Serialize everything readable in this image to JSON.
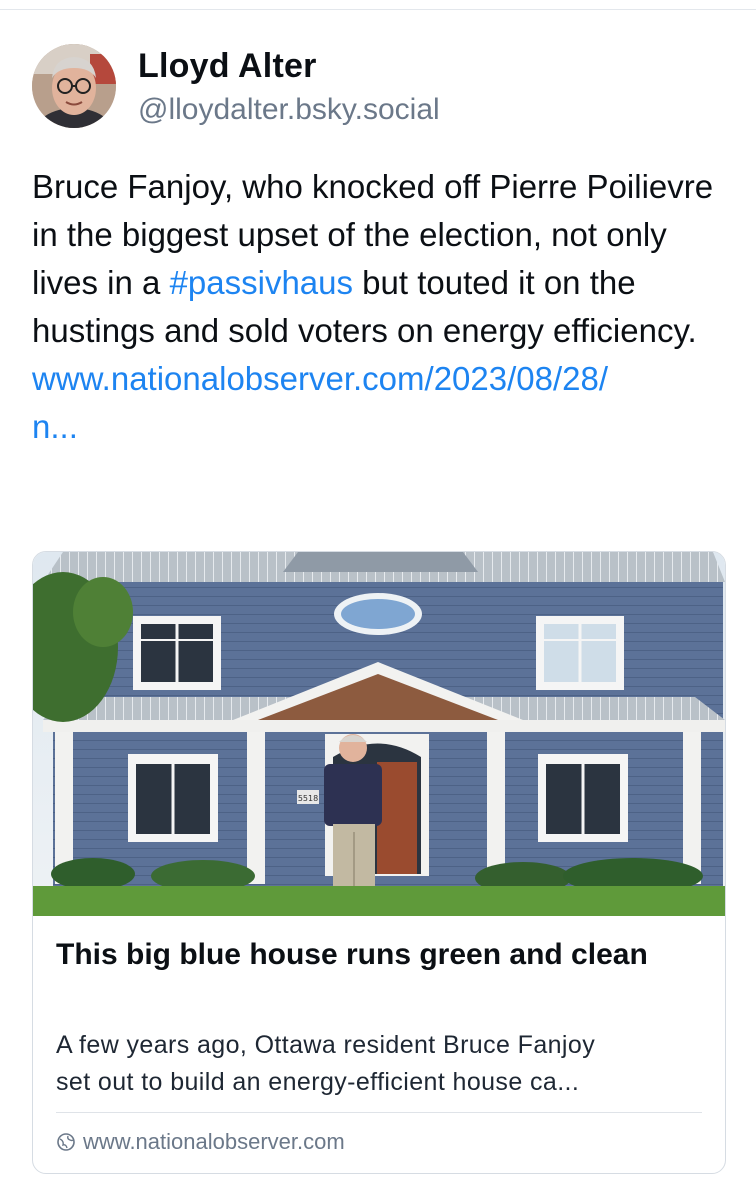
{
  "author": {
    "name": "Lloyd Alter",
    "handle": "@lloydalter.bsky.social"
  },
  "post": {
    "text_before_tag": "Bruce Fanjoy, who knocked off Pierre Poilievre in the biggest upset of the election, not only lives in a ",
    "hashtag": "#passivhaus",
    "text_after_tag": " but touted it on the hustings and sold voters on energy efficiency.",
    "link_line1": "www.nationalobserver.com/2023/08/28/",
    "link_line2": "n..."
  },
  "link_card": {
    "title": "This big blue house runs green and clean",
    "description_line1": "A few years ago, Ottawa resident Bruce Fanjoy",
    "description_line2": "set out to build an energy-efficient house ca...",
    "domain": "www.nationalobserver.com",
    "house_number": "5518"
  },
  "colors": {
    "link": "#1d84f1",
    "house_siding": "#5c7298",
    "handle_gray": "#6b7889"
  }
}
